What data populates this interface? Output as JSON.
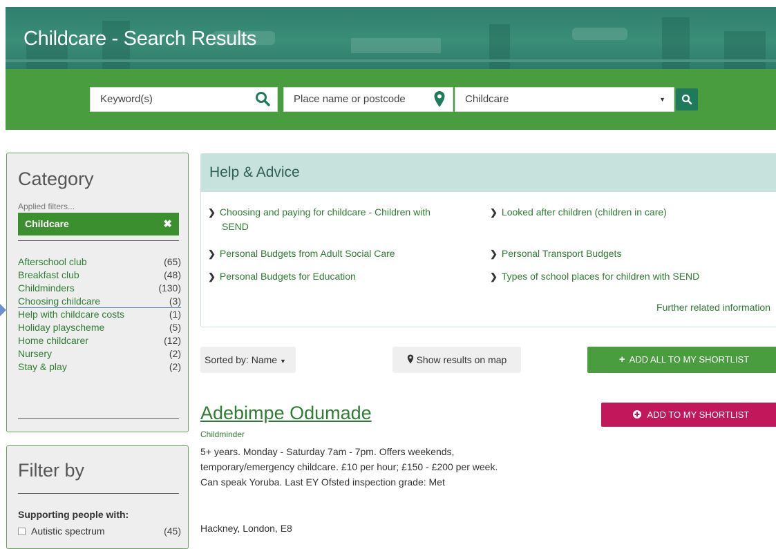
{
  "header": {
    "title": "Childcare - Search Results"
  },
  "search": {
    "keyword_placeholder": "Keyword(s)",
    "place_placeholder": "Place name or postcode",
    "type_value": "Childcare"
  },
  "category": {
    "title": "Category",
    "applied_label": "Applied filters...",
    "applied_chip": "Childcare",
    "items": [
      {
        "label": "Afterschool club",
        "count": "(65)"
      },
      {
        "label": "Breakfast club",
        "count": "(48)"
      },
      {
        "label": "Childminders",
        "count": "(130)"
      },
      {
        "label": "Choosing childcare",
        "count": "(3)"
      },
      {
        "label": "Help with childcare costs",
        "count": "(1)"
      },
      {
        "label": "Holiday playscheme",
        "count": "(5)"
      },
      {
        "label": "Home childcarer",
        "count": "(12)"
      },
      {
        "label": "Nursery",
        "count": "(2)"
      },
      {
        "label": "Stay & play",
        "count": "(2)"
      }
    ]
  },
  "filter": {
    "title": "Filter by",
    "supporting_label": "Supporting people with:",
    "options": [
      {
        "label": "Autistic spectrum",
        "count": "(45)"
      }
    ]
  },
  "help": {
    "title": "Help & Advice",
    "links": [
      {
        "line1": "Choosing and paying for childcare - Children with",
        "line2": "SEND"
      },
      {
        "line1": "Looked after children (children in care)"
      },
      {
        "line1": "Personal Budgets from Adult Social Care"
      },
      {
        "line1": "Personal Transport Budgets"
      },
      {
        "line1": "Personal Budgets for Education"
      },
      {
        "line1": "Types of school places for children with SEND"
      }
    ],
    "further": "Further related information"
  },
  "toolbar": {
    "sort_label": "Sorted by: Name",
    "map_label": "Show results on map",
    "add_all_label": "ADD ALL TO MY SHORTLIST"
  },
  "result": {
    "name": "Adebimpe Odumade",
    "type": "Childminder",
    "description": "5+ years. Monday - Saturday 7am - 7pm. Offers weekends, temporary/emergency childcare. £10 per hour; £150 - £200 per week. Can speak Yoruba. Last EY Ofsted inspection grade: Met",
    "address": "Hackney, London, E8",
    "shortlist_label": "ADD TO MY SHORTLIST"
  },
  "colors": {
    "banner": "#2f7f6d",
    "search_bar": "#4a9d3f",
    "link_green": "#2e7d32",
    "shortlist_red": "#c2185b",
    "help_header": "#c7e2dc"
  }
}
